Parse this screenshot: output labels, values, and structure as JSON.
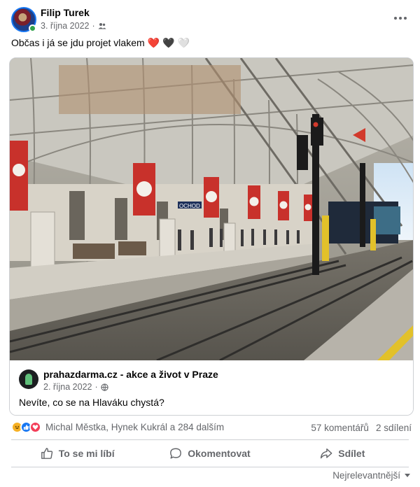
{
  "post": {
    "author": "Filip Turek",
    "date": "3. října 2022",
    "audience_icon": "friends-icon",
    "text": "Občas i já se jdu projet vlakem",
    "emojis": [
      "❤️",
      "🖤",
      "🤍"
    ]
  },
  "shared": {
    "author": "prahazdarma.cz - akce a život v Praze",
    "date": "2. října 2022",
    "audience_icon": "globe-icon",
    "text": "Nevíte, co se na Hlaváku chystá?",
    "photo_sign": "OCHOD"
  },
  "engagement": {
    "reactions": [
      "haha-icon",
      "like-icon",
      "love-icon"
    ],
    "names": "Michal Městka, Hynek Kukrál a 284 dalším",
    "comments": "57 komentářů",
    "shares": "2 sdílení"
  },
  "actions": {
    "like": "To se mi líbí",
    "comment": "Okomentovat",
    "share": "Sdílet"
  },
  "sort": {
    "label": "Nejrelevantnější"
  },
  "colors": {
    "accent": "#1877f2",
    "banner_red": "#c8312b",
    "muted_text": "#65676b"
  }
}
